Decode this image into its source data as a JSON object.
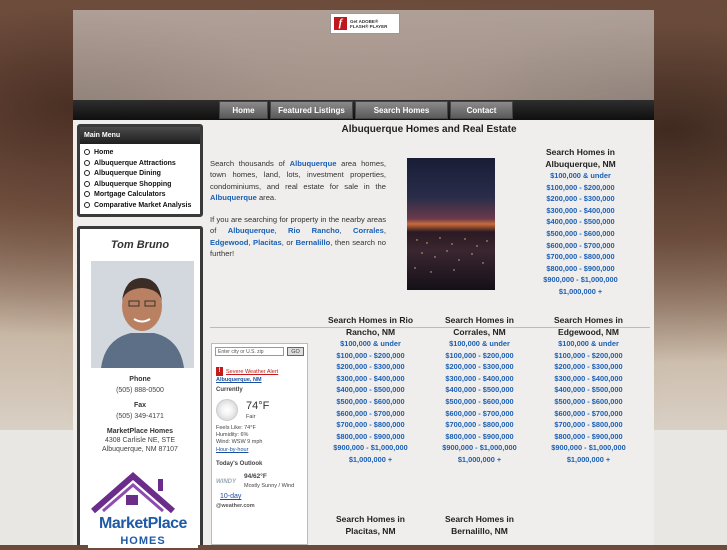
{
  "flash_badge": {
    "line1": "Get ADOBE®",
    "line2": "FLASH® PLAYER",
    "icon": "flash-icon"
  },
  "nav": [
    "Home",
    "Featured Listings",
    "Search Homes",
    "Contact"
  ],
  "menu": {
    "title": "Main Menu",
    "items": [
      "Home",
      "Albuquerque Attractions",
      "Albuquerque Dining",
      "Albuquerque Shopping",
      "Mortgage Calculators",
      "Comparative Market Analysis"
    ]
  },
  "agent": {
    "name": "Tom Bruno",
    "phone_label": "Phone",
    "phone": "(505) 888-0500",
    "fax_label": "Fax",
    "fax": "(505) 349-4171",
    "company": "MarketPlace Homes",
    "address1": "4308 Carlisle NE, STE",
    "address2": "Albuquerque, NM 87107",
    "logo_word1": "MarketPlace",
    "logo_word2": "HOMES"
  },
  "main": {
    "title": "Albuquerque Homes and Real Estate",
    "intro1_a": "Search thousands of ",
    "intro1_link1": "Albuquerque",
    "intro1_b": " area homes, town homes, land, lots, investment properties, condominiums, and real estate for sale in the ",
    "intro1_link2": "Albuquerque",
    "intro1_c": " area.",
    "intro2_a": "If you are searching for property in the nearby areas of ",
    "l_alb": "Albuquerque",
    "l_rr": "Rio Rancho",
    "l_cor": "Corrales",
    "l_edge": "Edgewood",
    "l_plac": "Placitas",
    "l_or": ", or ",
    "l_bern": "Bernalillo",
    "intro2_b": ", then search no further!"
  },
  "price_ranges": [
    "$100,000 & under",
    "$100,000 - $200,000",
    "$200,000 - $300,000",
    "$300,000 - $400,000",
    "$400,000 - $500,000",
    "$500,000 - $600,000",
    "$600,000 - $700,000",
    "$700,000 - $800,000",
    "$800,000 - $900,000",
    "$900,000 - $1,000,000",
    "$1,000,000 +"
  ],
  "searches": {
    "albuquerque": {
      "title": "Search Homes in Albuquerque, NM"
    },
    "rio_rancho": {
      "title": "Search Homes in Rio Rancho, NM"
    },
    "corrales": {
      "title": "Search Homes in Corrales, NM"
    },
    "edgewood": {
      "title": "Search Homes in Edgewood, NM"
    },
    "placitas": {
      "title": "Search Homes in Placitas, NM"
    },
    "bernalillo": {
      "title": "Search Homes in Bernalillo, NM"
    }
  },
  "weather": {
    "placeholder": "Enter city or U.S. zip",
    "go": "GO",
    "alert": "Severe Weather Alert",
    "location": "Albuquerque, NM",
    "current_label": "Currently",
    "temp": "74°F",
    "condition": "Fair",
    "feels": "Feels Like: 74°F",
    "humidity": "Humidity: 6%",
    "wind": "Wind: WSW 9 mph",
    "hourly": "Hour-by-hour",
    "outlook_label": "Today's Outlook",
    "outlook_icon_text": "WINDY",
    "hilo": "94/62°F",
    "outlook_cond": "Mostly Sunny / Wind",
    "tenday": "10-day",
    "brand": "@weather.com"
  }
}
